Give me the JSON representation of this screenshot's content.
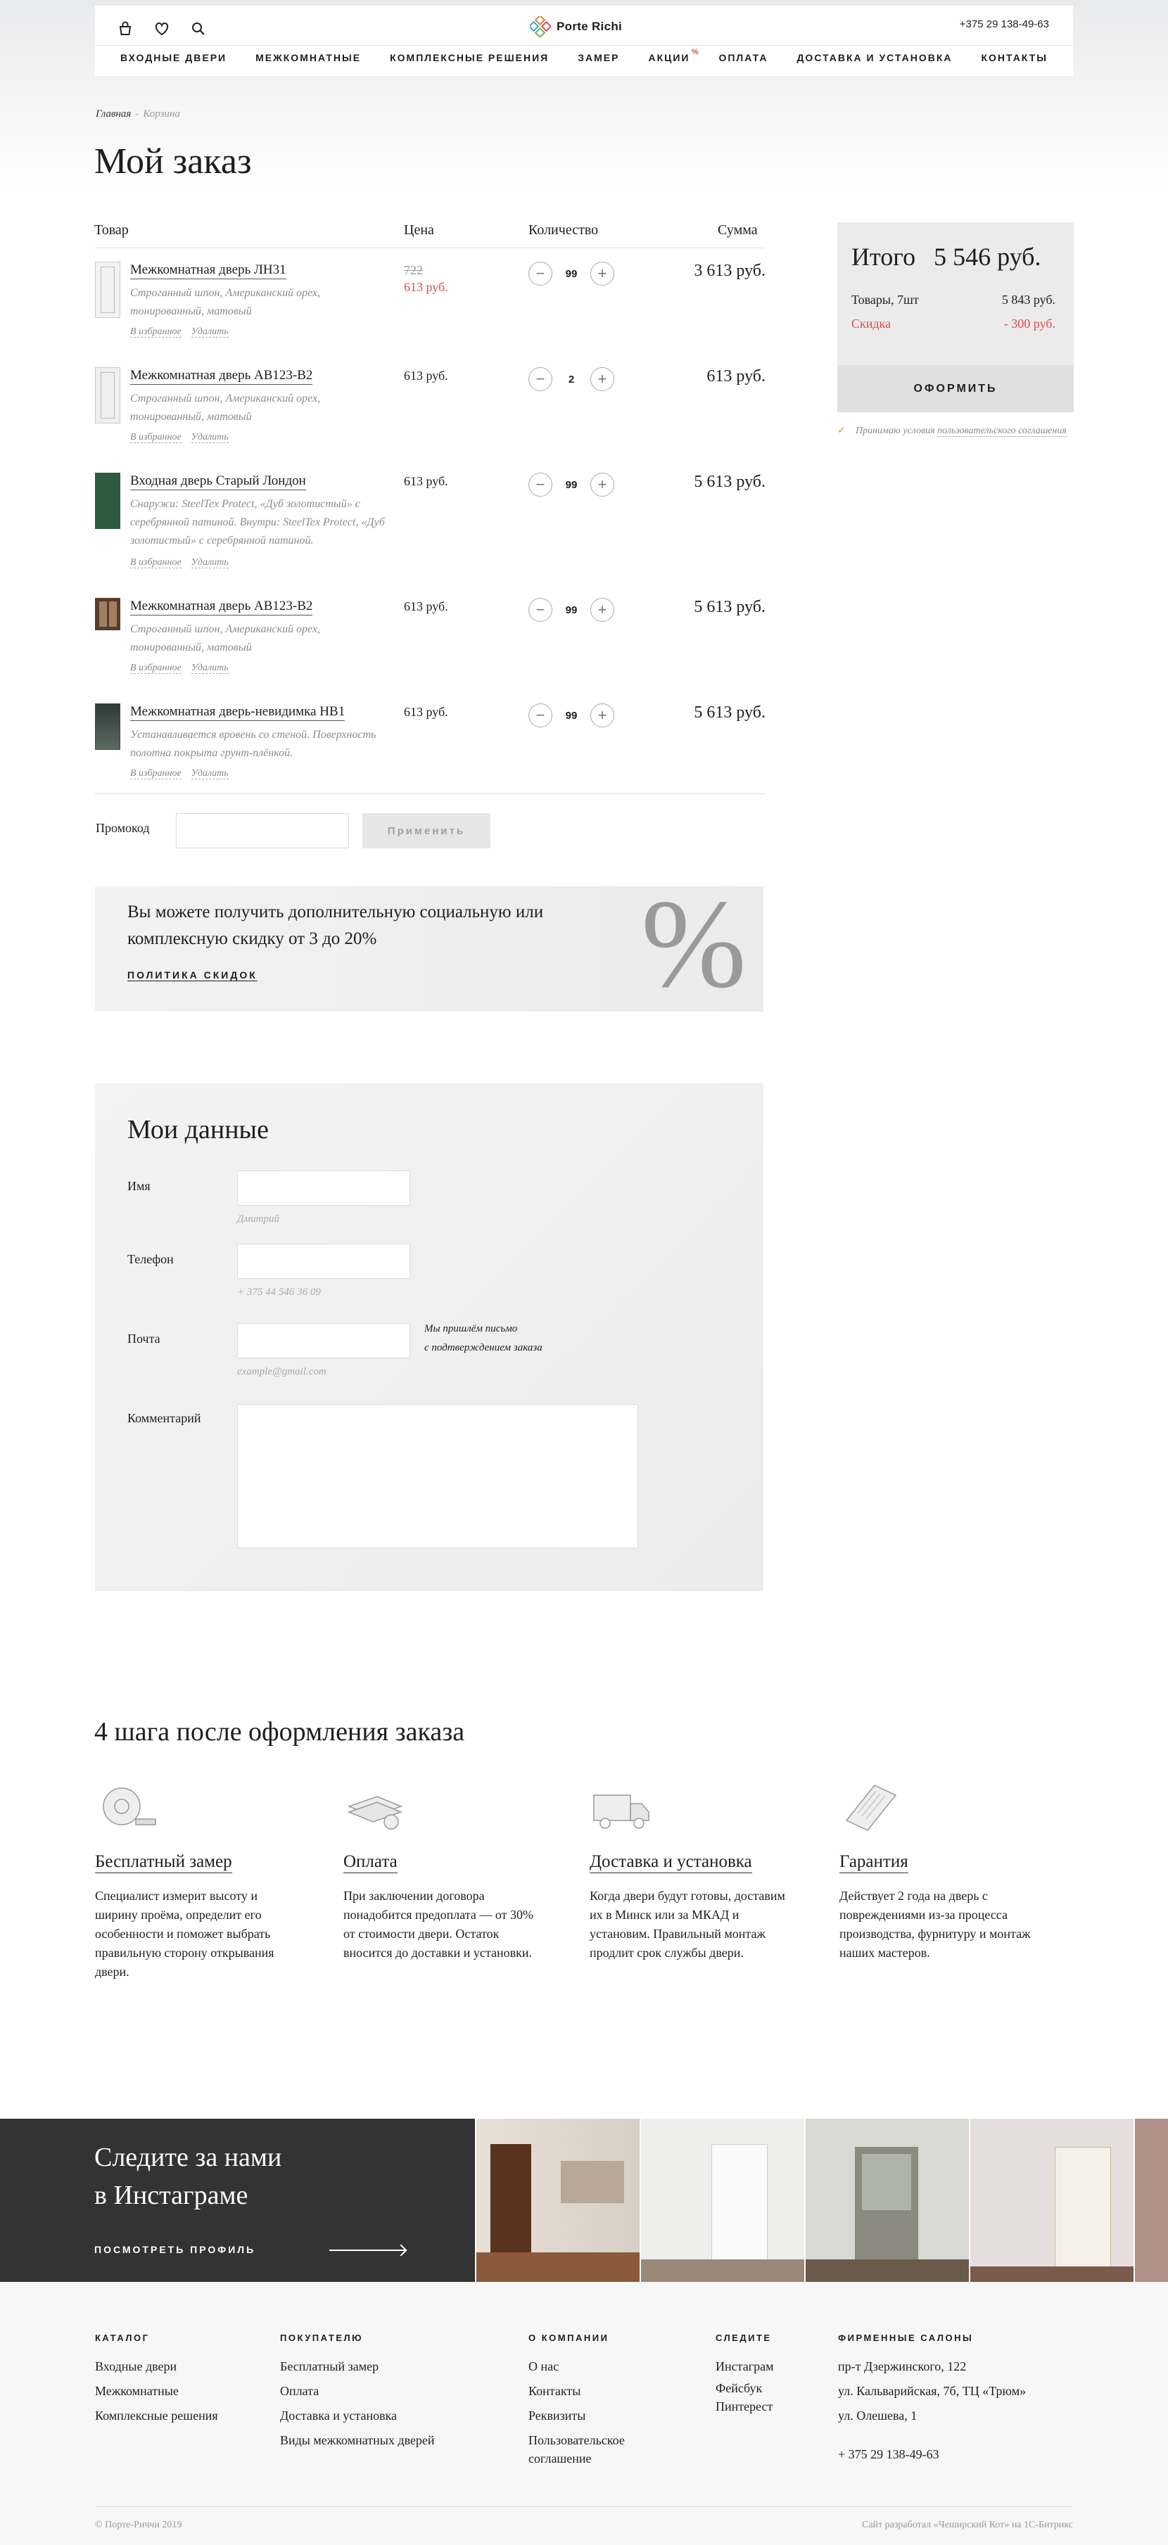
{
  "header": {
    "brand": "Porte Richi",
    "phone": "+375 29 138-49-63",
    "nav": [
      "Входные двери",
      "Межкомнатные",
      "Комплексные решения",
      "Замер",
      "Акции",
      "Оплата",
      "Доставка и установка",
      "Контакты"
    ],
    "nav_badge": "%"
  },
  "breadcrumb": {
    "home": "Главная",
    "sep": "-",
    "current": "Корзина"
  },
  "page_title": "Мой заказ",
  "cart": {
    "columns": {
      "product": "Товар",
      "price": "Цена",
      "qty": "Количество",
      "sum": "Сумма"
    },
    "items": [
      {
        "name": "Межкомнатная дверь ЛН31",
        "desc": "Строганный шпон, Американский орех, тонированный, матовый",
        "old_price": "722",
        "price": "613 руб.",
        "qty": "99",
        "sum": "3 613 руб.",
        "fav": "В избранное",
        "remove": "Удалить"
      },
      {
        "name": "Межкомнатная дверь АВ123-В2",
        "desc": "Строганный шпон, Американский орех, тонированный, матовый",
        "price": "613 руб.",
        "qty": "2",
        "sum": "613 руб.",
        "fav": "В избранное",
        "remove": "Удалить"
      },
      {
        "name": "Входная дверь Старый Лондон",
        "desc": "Снаружи: SteelTex Protect, «Дуб золотистый» с серебрянной патиной. Внутри: SteelTex Protect, «Дуб золотистый» с серебрянной патиной.",
        "price": "613 руб.",
        "qty": "99",
        "sum": "5 613 руб.",
        "fav": "В избранное",
        "remove": "Удалить"
      },
      {
        "name": "Межкомнатная дверь АВ123-В2",
        "desc": "Строганный шпон, Американский орех, тонированный, матовый",
        "price": "613 руб.",
        "qty": "99",
        "sum": "5 613 руб.",
        "fav": "В избранное",
        "remove": "Удалить"
      },
      {
        "name": "Межкомнатная дверь-невидимка НВ1",
        "desc": "Устанавливается вровень со стеной. Поверхность полотна покрыта грунт-плёнкой.",
        "price": "613 руб.",
        "qty": "99",
        "sum": "5 613 руб.",
        "fav": "В избранное",
        "remove": "Удалить"
      }
    ]
  },
  "summary": {
    "total_label": "Итого",
    "total_value": "5 546 руб.",
    "goods_label": "Товары, 7шт",
    "goods_value": "5 843 руб.",
    "discount_label": "Скидка",
    "discount_value": "- 300 руб.",
    "order_button": "Оформить",
    "agree_text": "Принимаю условия ",
    "agree_link": "пользовательского соглашения",
    "accent": "#e04b4b"
  },
  "promo": {
    "label": "Промокод",
    "apply": "Применить"
  },
  "discount_banner": {
    "text": "Вы можете получить дополнительную социальную или комплексную скидку от 3 до 20%",
    "link": "Политика скидок",
    "symbol": "%"
  },
  "my_data": {
    "title": "Мои данные",
    "name_label": "Имя",
    "name_hint": "Дмитрий",
    "phone_label": "Телефон",
    "phone_hint": "+ 375 44 546 36 09",
    "email_label": "Почта",
    "email_hint": "example@gmail.com",
    "email_note_1": "Мы пришлём письмо",
    "email_note_2": "с подтверждением заказа",
    "comment_label": "Комментарий"
  },
  "steps": {
    "title": "4 шага после оформления заказа",
    "items": [
      {
        "icon": "tape-measure-icon",
        "title": "Бесплатный замер",
        "text": "Специалист измерит высоту и ширину проёма, определит его особенности и поможет выбрать правильную сторону открывания двери."
      },
      {
        "icon": "money-icon",
        "title": "Оплата",
        "text": "При заключении договора понадобится предоплата — от 30% от стоимости двери. Остаток вносится до доставки и установки."
      },
      {
        "icon": "truck-icon",
        "title": "Доставка и установка",
        "text": "Когда двери будут готовы, доставим их в Минск или за МКАД и установим. Правильный монтаж продлит срок службы двери."
      },
      {
        "icon": "certificate-icon",
        "title": "Гарантия",
        "text": "Действует 2 года на дверь с повреждениями из-за процесса производства, фурнитуру и монтаж наших мастеров."
      }
    ]
  },
  "instagram": {
    "title_1": "Следите за нами",
    "title_2": "в Инстаграме",
    "link": "Посмотреть профиль"
  },
  "footer": {
    "catalog": {
      "title": "Каталог",
      "items": [
        "Входные двери",
        "Межкомнатные",
        "Комплексные решения"
      ]
    },
    "buyer": {
      "title": "Покупателю",
      "items": [
        "Бесплатный замер",
        "Оплата",
        "Доставка и установка",
        "Виды межкомнатных дверей"
      ]
    },
    "company": {
      "title": "О компании",
      "items": [
        "О нас",
        "Контакты",
        "Реквизиты",
        "Пользовательское соглашение"
      ]
    },
    "follow": {
      "title": "Следите",
      "items": [
        "Инстаграм",
        "Фейсбук",
        "Пинтерест"
      ]
    },
    "salons": {
      "title": "Фирменные салоны",
      "items": [
        "пр-т Дзержинского, 122",
        "ул. Кальварийская, 7б, ТЦ «Трюм»",
        "ул. Олешева, 1"
      ],
      "phone": "+ 375 29 138-49-63"
    },
    "copyright": "© Порте-Риччи 2019",
    "developer": "Сайт разработал «Чеширский Кот» на 1С-Битрикс"
  }
}
